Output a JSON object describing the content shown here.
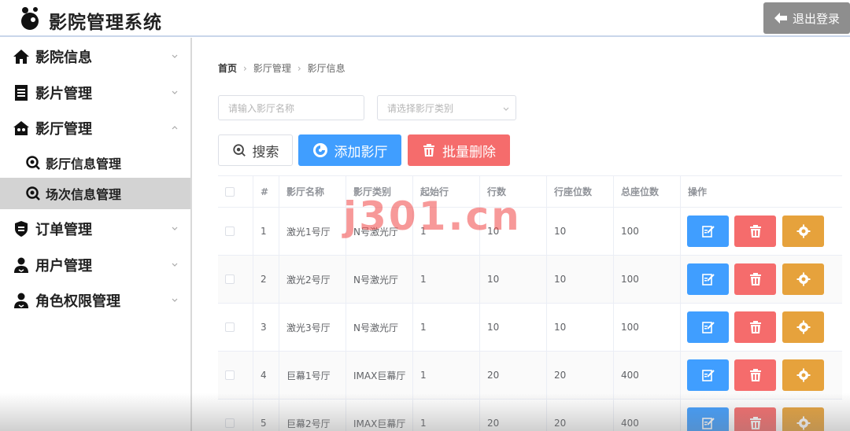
{
  "app": {
    "title": "影院管理系统",
    "logout_label": "退出登录"
  },
  "sidebar": {
    "menus": [
      {
        "label": "影院信息",
        "icon": "home-icon",
        "expanded": false
      },
      {
        "label": "影片管理",
        "icon": "document-icon",
        "expanded": false
      },
      {
        "label": "影厅管理",
        "icon": "theater-icon",
        "expanded": true
      },
      {
        "label": "订单管理",
        "icon": "order-shield-icon",
        "expanded": false
      },
      {
        "label": "用户管理",
        "icon": "user-icon",
        "expanded": false
      },
      {
        "label": "角色权限管理",
        "icon": "role-user-icon",
        "expanded": false
      }
    ],
    "submenus": [
      {
        "label": "影厅信息管理",
        "icon": "search-icon",
        "active": false
      },
      {
        "label": "场次信息管理",
        "icon": "search-icon",
        "active": true
      }
    ]
  },
  "breadcrumb": [
    "首页",
    "影厅管理",
    "影厅信息"
  ],
  "filters": {
    "name_placeholder": "请输入影厅名称",
    "type_placeholder": "请选择影厅类别"
  },
  "toolbar": {
    "search_label": "搜索",
    "add_label": "添加影厅",
    "batch_delete_label": "批量删除"
  },
  "table": {
    "headers": [
      "#",
      "影厅名称",
      "影厅类别",
      "起始行",
      "行数",
      "行座位数",
      "总座位数",
      "操作"
    ],
    "rows": [
      {
        "id": "1",
        "name": "激光1号厅",
        "type": "N号激光厅",
        "start_row": "1",
        "rows": "10",
        "seats_per_row": "10",
        "total_seats": "100"
      },
      {
        "id": "2",
        "name": "激光2号厅",
        "type": "N号激光厅",
        "start_row": "1",
        "rows": "10",
        "seats_per_row": "10",
        "total_seats": "100"
      },
      {
        "id": "3",
        "name": "激光3号厅",
        "type": "N号激光厅",
        "start_row": "1",
        "rows": "10",
        "seats_per_row": "10",
        "total_seats": "100"
      },
      {
        "id": "4",
        "name": "巨幕1号厅",
        "type": "IMAX巨幕厅",
        "start_row": "1",
        "rows": "20",
        "seats_per_row": "20",
        "total_seats": "400"
      },
      {
        "id": "5",
        "name": "巨幕2号厅",
        "type": "IMAX巨幕厅",
        "start_row": "1",
        "rows": "20",
        "seats_per_row": "20",
        "total_seats": "400"
      }
    ]
  },
  "watermark": "j301.cn",
  "colors": {
    "primary": "#409eff",
    "danger": "#f56c6c",
    "warning": "#e6a23c",
    "logout_bg": "#8e8e8e"
  }
}
